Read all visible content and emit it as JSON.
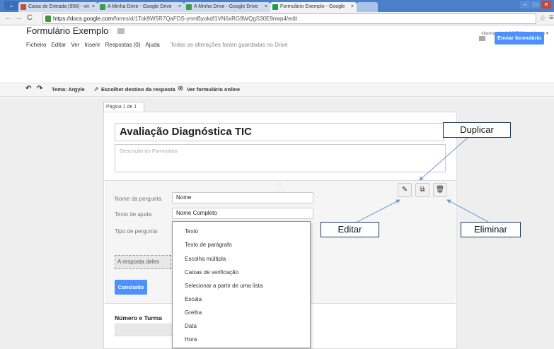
{
  "browser": {
    "tabs": [
      {
        "label": "Caixa de Entrada (956) - vit",
        "favicon_color": "#d14836"
      },
      {
        "label": "A Minha Drive - Google Drive",
        "favicon_color": "#3d9b4e"
      },
      {
        "label": "A Minha Drive - Google Drive",
        "favicon_color": "#3d9b4e"
      },
      {
        "label": "Formulário Exemplo - Google",
        "favicon_color": "#1a9b57"
      }
    ],
    "url_domain": "https://docs.google.com",
    "url_path": "/forms/d/1Tok9W5R7QaFDS-ynmByokdf1VN6xRG9WQgS30E9nwp4/edit",
    "close_glyph": "×"
  },
  "header": {
    "title": "Formulário Exemplo",
    "star": "☆",
    "menu": [
      "Ficheiro",
      "Editar",
      "Ver",
      "Inserir",
      "Respostas (0)",
      "Ajuda"
    ],
    "saved_message": "Todas as alterações foram guardadas no Drive",
    "account_email": "vitormachado2007@gmail.com ▾",
    "send_button": "Enviar formulário"
  },
  "toolbar": {
    "theme": "Tema: Argyle",
    "destination": "Escolher destino da resposta",
    "view_online": "Ver formulário online"
  },
  "form": {
    "page_tab": "Página 1 de 1",
    "title": "Avaliação Diagnóstica TIC",
    "description_placeholder": "Descrição do Formulário",
    "question": {
      "name_label": "Nome da pergunta",
      "name_value": "Nome",
      "help_label": "Texto de ajuda",
      "help_value": "Nome Completo",
      "type_label": "Tipo de pergunta",
      "answer_placeholder": "A resposta deles",
      "done_button": "Concluído",
      "drag_dots": "::::"
    },
    "type_options": [
      "Texto",
      "Texto de parágrafo",
      "Escolha múltipla",
      "Caixas de verificação",
      "Selecionar a partir de uma lista",
      "Escala",
      "Grelha",
      "Data",
      "Hora"
    ],
    "next_question_label": "Número e Turma"
  },
  "callouts": {
    "duplicate": "Duplicar",
    "edit": "Editar",
    "delete": "Eliminar"
  },
  "colors": {
    "accent_blue": "#4d90fe",
    "callout_arrow": "#6f9bd1"
  }
}
